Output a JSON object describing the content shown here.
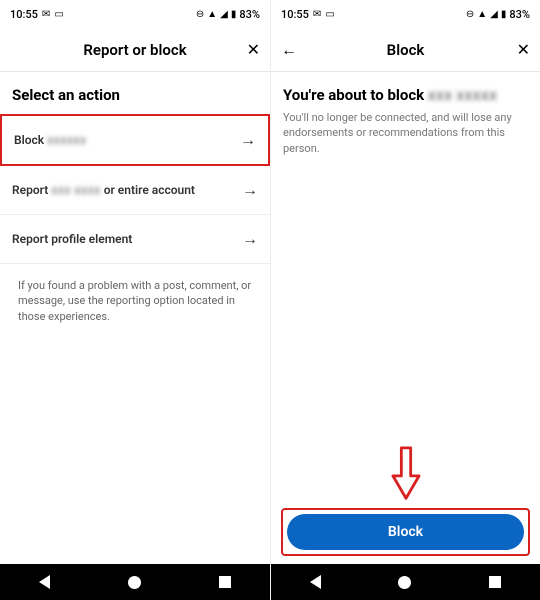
{
  "status": {
    "time": "10:55",
    "battery": "83%"
  },
  "left": {
    "title": "Report or block",
    "section_title": "Select an action",
    "actions": [
      {
        "label": "Block",
        "blurred": "xxxxxx"
      },
      {
        "label_prefix": "Report",
        "blurred": "xxx xxxx",
        "label_suffix": "or entire account"
      },
      {
        "label": "Report profile element"
      }
    ],
    "helper": "If you found a problem with a post, comment, or message, use the reporting option located in those experiences."
  },
  "right": {
    "title": "Block",
    "heading_prefix": "You're about to block",
    "heading_blur": "xxx xxxxx",
    "description": "You'll no longer be connected, and will lose any endorsements or recommendations from this person.",
    "primary_button": "Block"
  }
}
